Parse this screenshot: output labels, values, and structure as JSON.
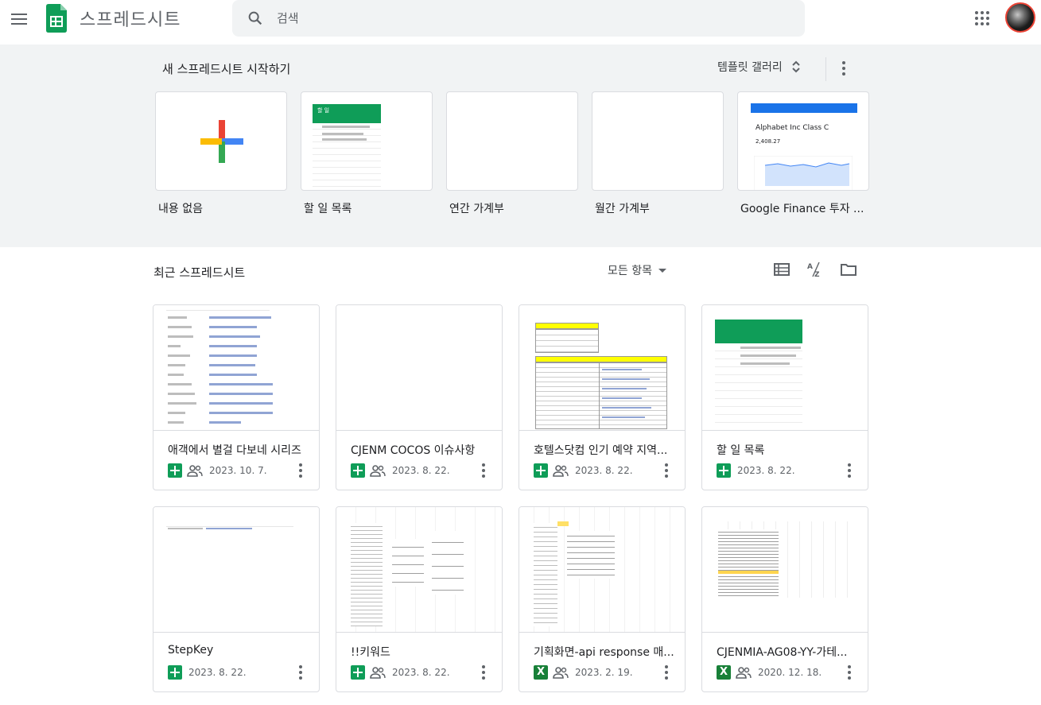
{
  "app": {
    "title": "스프레드시트"
  },
  "search": {
    "placeholder": "검색"
  },
  "gallery": {
    "title": "새 스프레드시트 시작하기",
    "template_gallery_label": "템플릿 갤러리",
    "templates": [
      {
        "label": "내용 없음",
        "icon": "plus-icon"
      },
      {
        "label": "할 일 목록",
        "icon": "todo-thumb"
      },
      {
        "label": "연간 가계부",
        "icon": "blank-thumb"
      },
      {
        "label": "월간 가계부",
        "icon": "blank-thumb"
      },
      {
        "label": "Google Finance 투자 ...",
        "icon": "finance-thumb"
      }
    ],
    "finance_thumb": {
      "company": "Alphabet Inc Class C",
      "price": "2,408.27"
    },
    "todo_thumb": {
      "title": "할 일"
    }
  },
  "recent": {
    "title": "최근 스프레드시트",
    "owner_filter": "모든 항목",
    "docs": [
      {
        "title": "애객에서 별걸 다보네 시리즈",
        "date": "2023. 10. 7.",
        "type": "sheet",
        "shared": true
      },
      {
        "title": "CJENM COCOS 이슈사항",
        "date": "2023. 8. 22.",
        "type": "sheet",
        "shared": true
      },
      {
        "title": "호텔스닷컴 인기 예약 지역...",
        "date": "2023. 8. 22.",
        "type": "sheet",
        "shared": true
      },
      {
        "title": "할 일 목록",
        "date": "2023. 8. 22.",
        "type": "sheet",
        "shared": false
      },
      {
        "title": "StepKey",
        "date": "2023. 8. 22.",
        "type": "sheet",
        "shared": false
      },
      {
        "title": "!!키워드",
        "date": "2023. 8. 22.",
        "type": "sheet",
        "shared": true
      },
      {
        "title": "기획화면-api response 매...",
        "date": "2023. 2. 19.",
        "type": "excel",
        "shared": true
      },
      {
        "title": "CJENMIA-AG08-YY-가테...",
        "date": "2020. 12. 18.",
        "type": "excel",
        "shared": true
      }
    ]
  },
  "icons": {
    "excel_letter": "X"
  },
  "colors": {
    "sheets_green": "#0f9d58",
    "gallery_bg": "#f1f3f4",
    "border": "#dadce0"
  }
}
